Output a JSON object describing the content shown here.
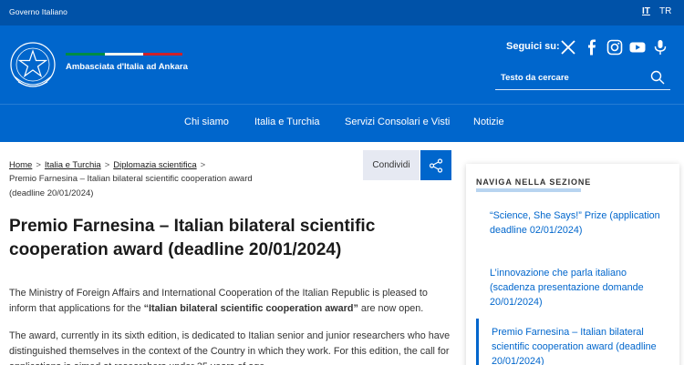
{
  "topbar": {
    "gov_label": "Governo Italiano",
    "lang_it": "IT",
    "lang_tr": "TR"
  },
  "header": {
    "site_name": "Ambasciata d'Italia ad Ankara",
    "follow_label": "Seguici su:",
    "search_placeholder": "Testo da cercare",
    "flag_colors": [
      "#008c45",
      "#f4f5f0",
      "#cd212a"
    ],
    "social_icons": [
      "x-icon",
      "facebook-icon",
      "instagram-icon",
      "youtube-icon",
      "podcast-icon"
    ]
  },
  "nav": {
    "items": [
      "Chi siamo",
      "Italia e Turchia",
      "Servizi Consolari e Visti",
      "Notizie"
    ]
  },
  "breadcrumb": {
    "items": [
      "Home",
      "Italia e Turchia",
      "Diplomazia scientifica"
    ],
    "current": "Premio Farnesina – Italian bilateral scientific cooperation award (deadline 20/01/2024)"
  },
  "share": {
    "label": "Condividi"
  },
  "article": {
    "title": "Premio Farnesina – Italian bilateral scientific cooperation award (deadline 20/01/2024)",
    "p1_a": "The Ministry of Foreign Affairs and International Cooperation of the Italian Republic is pleased to inform that applications for the ",
    "p1_bold": "“Italian bilateral scientific cooperation award”",
    "p1_b": " are now open.",
    "p2": "The award, currently in its sixth edition, is dedicated to Italian senior and junior researchers who have distinguished themselves in the context of the Country in which they work. For this edition, the call for applications is aimed at researchers under 35 years of age."
  },
  "sidebar": {
    "heading": "NAVIGA NELLA SEZIONE",
    "items": [
      "“Science, She Says!” Prize (application deadline 02/01/2024)",
      "L’innovazione che parla italiano (scadenza presentazione domande 20/01/2024)",
      "Premio Farnesina – Italian bilateral scientific cooperation award (deadline 20/01/2024)"
    ]
  },
  "colors": {
    "top_bar": "#0052a8",
    "header": "#0066cc",
    "link": "#0066cc"
  }
}
